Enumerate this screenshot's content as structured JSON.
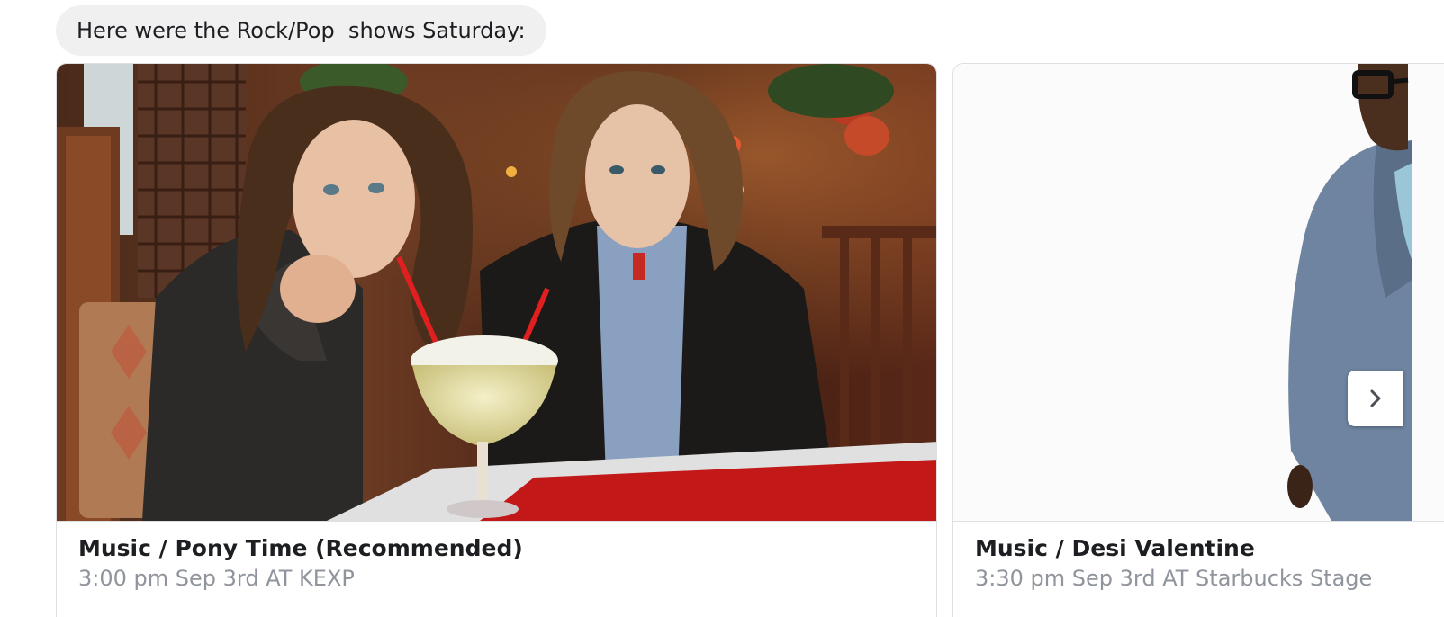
{
  "message": {
    "text": "Here were the Rock/Pop  shows Saturday:"
  },
  "cards": [
    {
      "title": "Music / Pony Time (Recommended)",
      "subtitle": "3:00 pm Sep 3rd AT KEXP"
    },
    {
      "title": "Music / Desi Valentine",
      "subtitle": "3:30 pm Sep 3rd AT Starbucks Stage"
    }
  ],
  "carousel": {
    "next_icon": "chevron-right-icon"
  },
  "colors": {
    "bubble_bg": "#f0f0f0",
    "title_text": "#1c1e21",
    "subtitle_text": "#90949c",
    "card_border": "#dddfe2"
  }
}
